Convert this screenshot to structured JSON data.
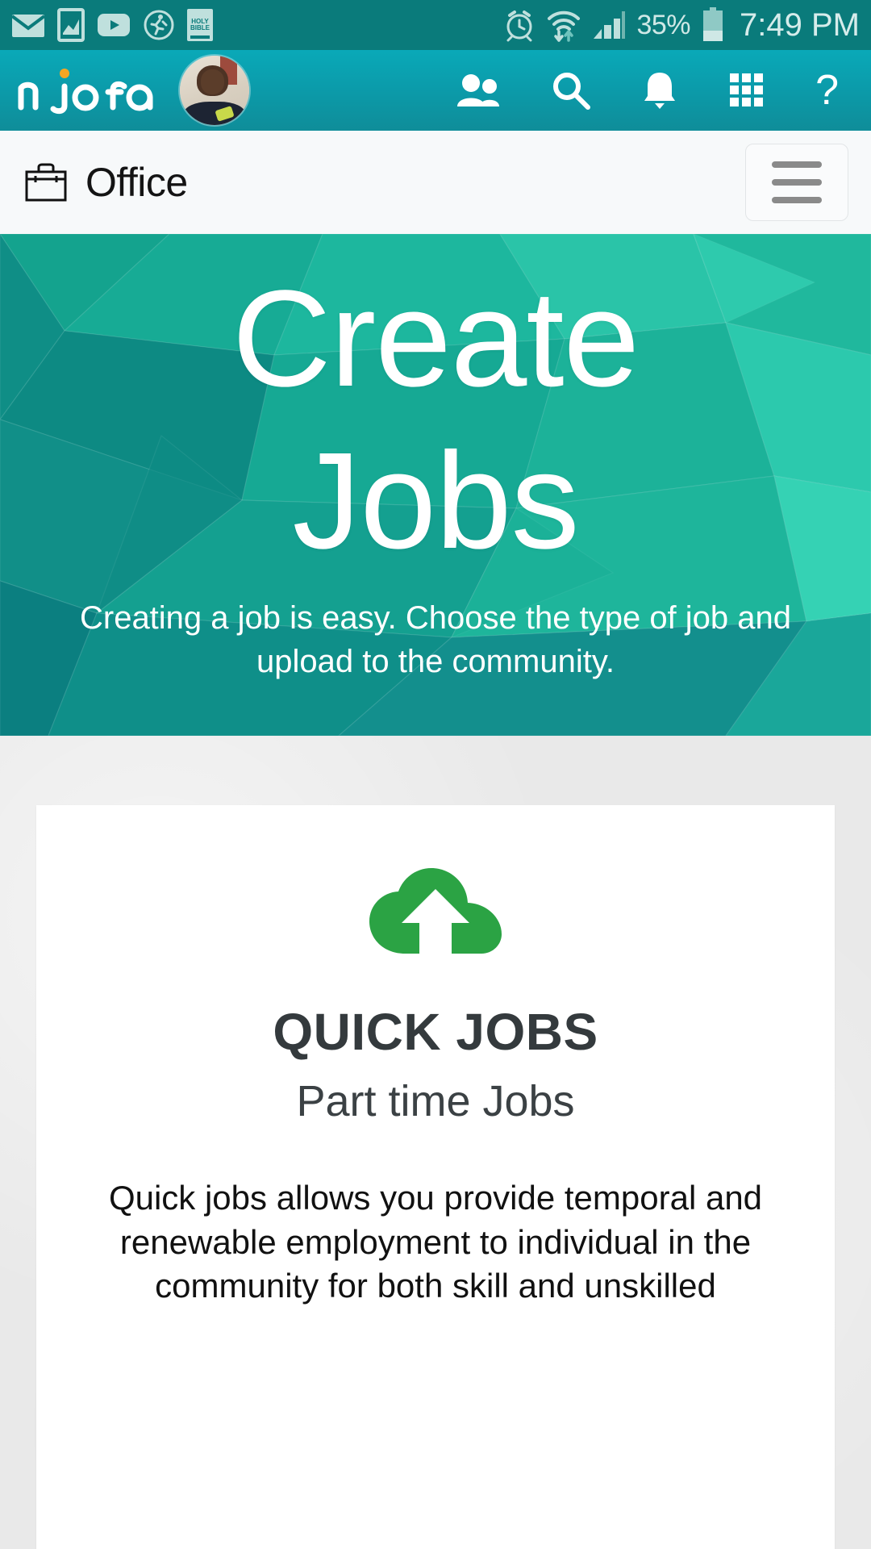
{
  "status_bar": {
    "left_icons": [
      "email-icon",
      "gallery-icon",
      "youtube-icon",
      "fitness-icon",
      "bible-icon"
    ],
    "bible_line1": "HOLY",
    "bible_line2": "BIBLE",
    "right_icons": [
      "alarm-icon",
      "wifi-icon",
      "signal-icon"
    ],
    "battery_percent": "35%",
    "battery_level": 35,
    "time": "7:49 PM"
  },
  "app_header": {
    "logo_text": "njofa",
    "avatar_label": "user-avatar",
    "icons": [
      {
        "name": "friends-icon",
        "label": "Friends"
      },
      {
        "name": "search-icon",
        "label": "Search"
      },
      {
        "name": "bell-icon",
        "label": "Notifications"
      },
      {
        "name": "apps-grid-icon",
        "label": "Apps"
      },
      {
        "name": "help-icon",
        "label": "?"
      }
    ]
  },
  "sub_header": {
    "icon": "briefcase-icon",
    "title": "Office",
    "menu_button": "hamburger-menu"
  },
  "hero": {
    "title_line1": "Create",
    "title_line2": "Jobs",
    "subtitle": "Creating a job is easy. Choose the type of job and upload to the community."
  },
  "card": {
    "icon": "cloud-upload-icon",
    "heading": "QUICK JOBS",
    "subheading": "Part time Jobs",
    "body": "Quick jobs allows you provide temporal and renewable employment to individual in the community for both skill and unskilled"
  },
  "colors": {
    "status_bar_bg": "#0a7b7b",
    "header_gradient_top": "#0aa9b8",
    "header_gradient_bottom": "#0f8d99",
    "hero_green": "#13a08d",
    "hero_teal_dark": "#0e7f84",
    "cloud_green": "#2ba344",
    "page_bg": "#e9e9e9",
    "card_bg": "#ffffff",
    "logo_accent": "#f5a623"
  }
}
